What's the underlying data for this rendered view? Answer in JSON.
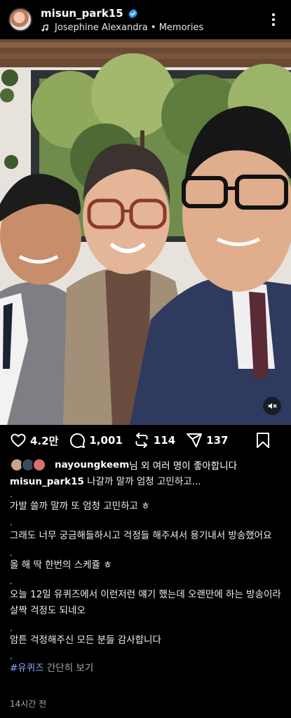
{
  "header": {
    "username": "misun_park15",
    "verified": true,
    "music": "Josephine Alexandra • Memories",
    "icons": [
      "verified-badge-icon",
      "music-note-icon",
      "more-vertical-icon"
    ]
  },
  "photo": {
    "description_icon": "mute-icon"
  },
  "actions": {
    "like_count": "4.2만",
    "comment_count": "1,001",
    "repost_count": "114",
    "share_count": "137",
    "icons": [
      "heart-icon",
      "comment-icon",
      "repost-icon",
      "share-icon",
      "bookmark-icon"
    ]
  },
  "likes": {
    "user": "nayoungkeem",
    "rest": "님 외 여러 명이 좋아합니다"
  },
  "caption": {
    "username": "misun_park15",
    "first_line": " 나갈까 말까  엄청  고민하고...",
    "dot": ".",
    "line2": "가발  쓸까 말까  또  엄청  고민하고 ㅎ",
    "line3": "그래도  너무  궁금해들하시고  걱정들  해주셔서  용기내서  방송했어요",
    "line4": "올 해  딱  한번의  스케쥴 ㅎ",
    "line5": "오늘  12일  유퀴즈에서  이런저런  얘기  했는데  오랜만에  하는 방송이라  살짝  걱정도  되네오",
    "line6": "암튼  걱정해주신  모든  분들  감사합니다",
    "hashtag": "#유퀴즈",
    "more": " 간단히 보기"
  },
  "timestamp": "14시간 전",
  "colors": {
    "background": "#000000",
    "hashtag": "#8ea6ff",
    "verified": "#3797f0",
    "secondary": "#a8a8a8"
  }
}
